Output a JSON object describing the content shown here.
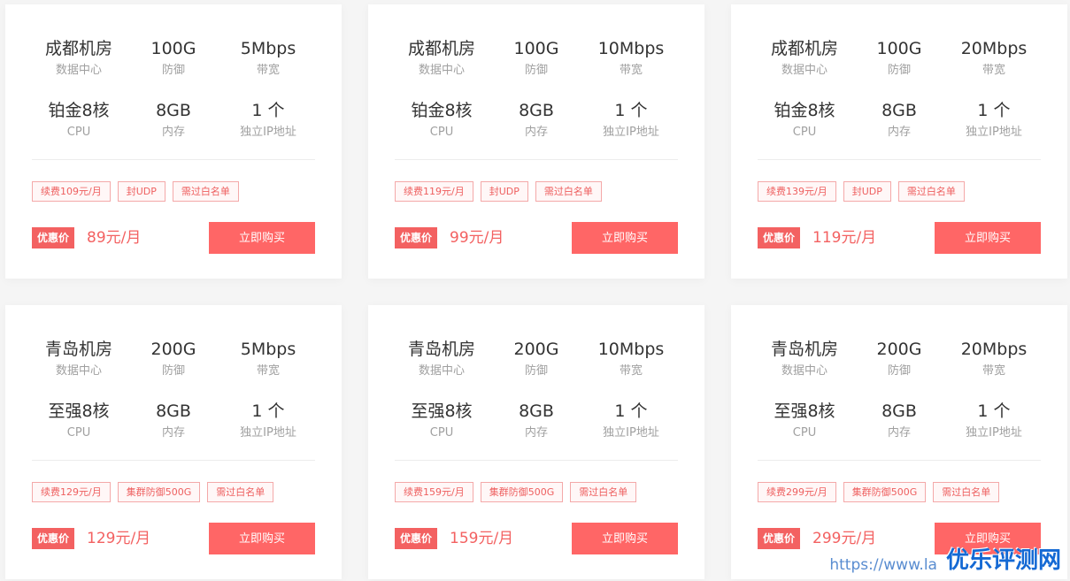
{
  "plans": [
    {
      "specs": [
        {
          "value": "成都机房",
          "label": "数据中心"
        },
        {
          "value": "100G",
          "label": "防御"
        },
        {
          "value": "5Mbps",
          "label": "带宽"
        },
        {
          "value": "铂金8核",
          "label": "CPU"
        },
        {
          "value": "8GB",
          "label": "内存"
        },
        {
          "value": "1 个",
          "label": "独立IP地址"
        }
      ],
      "tags": [
        "续费109元/月",
        "封UDP",
        "需过白名单"
      ],
      "badge": "优惠价",
      "price": "89元/月",
      "button": "立即购买"
    },
    {
      "specs": [
        {
          "value": "成都机房",
          "label": "数据中心"
        },
        {
          "value": "100G",
          "label": "防御"
        },
        {
          "value": "10Mbps",
          "label": "带宽"
        },
        {
          "value": "铂金8核",
          "label": "CPU"
        },
        {
          "value": "8GB",
          "label": "内存"
        },
        {
          "value": "1 个",
          "label": "独立IP地址"
        }
      ],
      "tags": [
        "续费119元/月",
        "封UDP",
        "需过白名单"
      ],
      "badge": "优惠价",
      "price": "99元/月",
      "button": "立即购买"
    },
    {
      "specs": [
        {
          "value": "成都机房",
          "label": "数据中心"
        },
        {
          "value": "100G",
          "label": "防御"
        },
        {
          "value": "20Mbps",
          "label": "带宽"
        },
        {
          "value": "铂金8核",
          "label": "CPU"
        },
        {
          "value": "8GB",
          "label": "内存"
        },
        {
          "value": "1 个",
          "label": "独立IP地址"
        }
      ],
      "tags": [
        "续费139元/月",
        "封UDP",
        "需过白名单"
      ],
      "badge": "优惠价",
      "price": "119元/月",
      "button": "立即购买"
    },
    {
      "specs": [
        {
          "value": "青岛机房",
          "label": "数据中心"
        },
        {
          "value": "200G",
          "label": "防御"
        },
        {
          "value": "5Mbps",
          "label": "带宽"
        },
        {
          "value": "至强8核",
          "label": "CPU"
        },
        {
          "value": "8GB",
          "label": "内存"
        },
        {
          "value": "1 个",
          "label": "独立IP地址"
        }
      ],
      "tags": [
        "续费129元/月",
        "集群防御500G",
        "需过白名单"
      ],
      "badge": "优惠价",
      "price": "129元/月",
      "button": "立即购买"
    },
    {
      "specs": [
        {
          "value": "青岛机房",
          "label": "数据中心"
        },
        {
          "value": "200G",
          "label": "防御"
        },
        {
          "value": "10Mbps",
          "label": "带宽"
        },
        {
          "value": "至强8核",
          "label": "CPU"
        },
        {
          "value": "8GB",
          "label": "内存"
        },
        {
          "value": "1 个",
          "label": "独立IP地址"
        }
      ],
      "tags": [
        "续费159元/月",
        "集群防御500G",
        "需过白名单"
      ],
      "badge": "优惠价",
      "price": "159元/月",
      "button": "立即购买"
    },
    {
      "specs": [
        {
          "value": "青岛机房",
          "label": "数据中心"
        },
        {
          "value": "200G",
          "label": "防御"
        },
        {
          "value": "20Mbps",
          "label": "带宽"
        },
        {
          "value": "至强8核",
          "label": "CPU"
        },
        {
          "value": "8GB",
          "label": "内存"
        },
        {
          "value": "1 个",
          "label": "独立IP地址"
        }
      ],
      "tags": [
        "续费299元/月",
        "集群防御500G",
        "需过白名单"
      ],
      "badge": "优惠价",
      "price": "299元/月",
      "button": "立即购买"
    }
  ],
  "watermark": {
    "url": "https://www.la",
    "logo": "优乐评测网"
  },
  "colors": {
    "accent": "#ff6666",
    "price": "#f36161",
    "tag_border": "#f4a9a9",
    "text": "#333333",
    "muted": "#a0a0a0"
  }
}
